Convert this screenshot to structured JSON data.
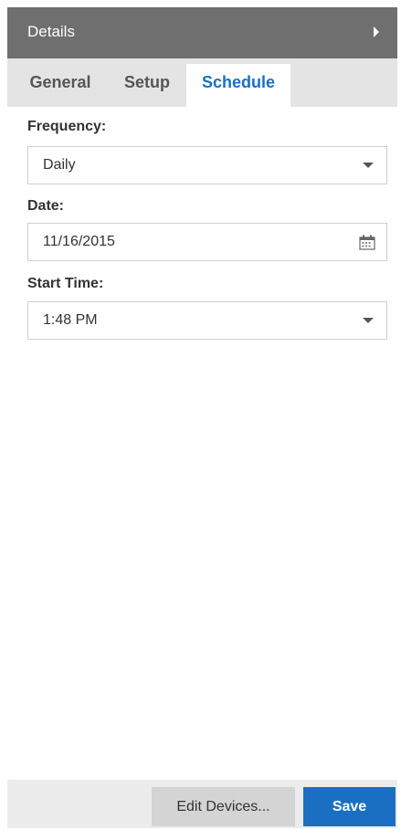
{
  "header": {
    "title": "Details",
    "collapse_icon": "triangle-right-icon"
  },
  "tabs": [
    {
      "label": "General",
      "selected": false
    },
    {
      "label": "Setup",
      "selected": false
    },
    {
      "label": "Schedule",
      "selected": true
    }
  ],
  "form": {
    "frequency": {
      "label": "Frequency:",
      "value": "Daily"
    },
    "date": {
      "label": "Date:",
      "value": "11/16/2015",
      "icon": "calendar-icon"
    },
    "start_time": {
      "label": "Start Time:",
      "value": "1:48 PM"
    }
  },
  "footer": {
    "edit_devices_label": "Edit Devices...",
    "save_label": "Save"
  },
  "colors": {
    "header_bg": "#6f6f6f",
    "accent": "#1b6fc2",
    "tabbar_bg": "#e4e4e4",
    "footer_bg": "#ececec"
  }
}
